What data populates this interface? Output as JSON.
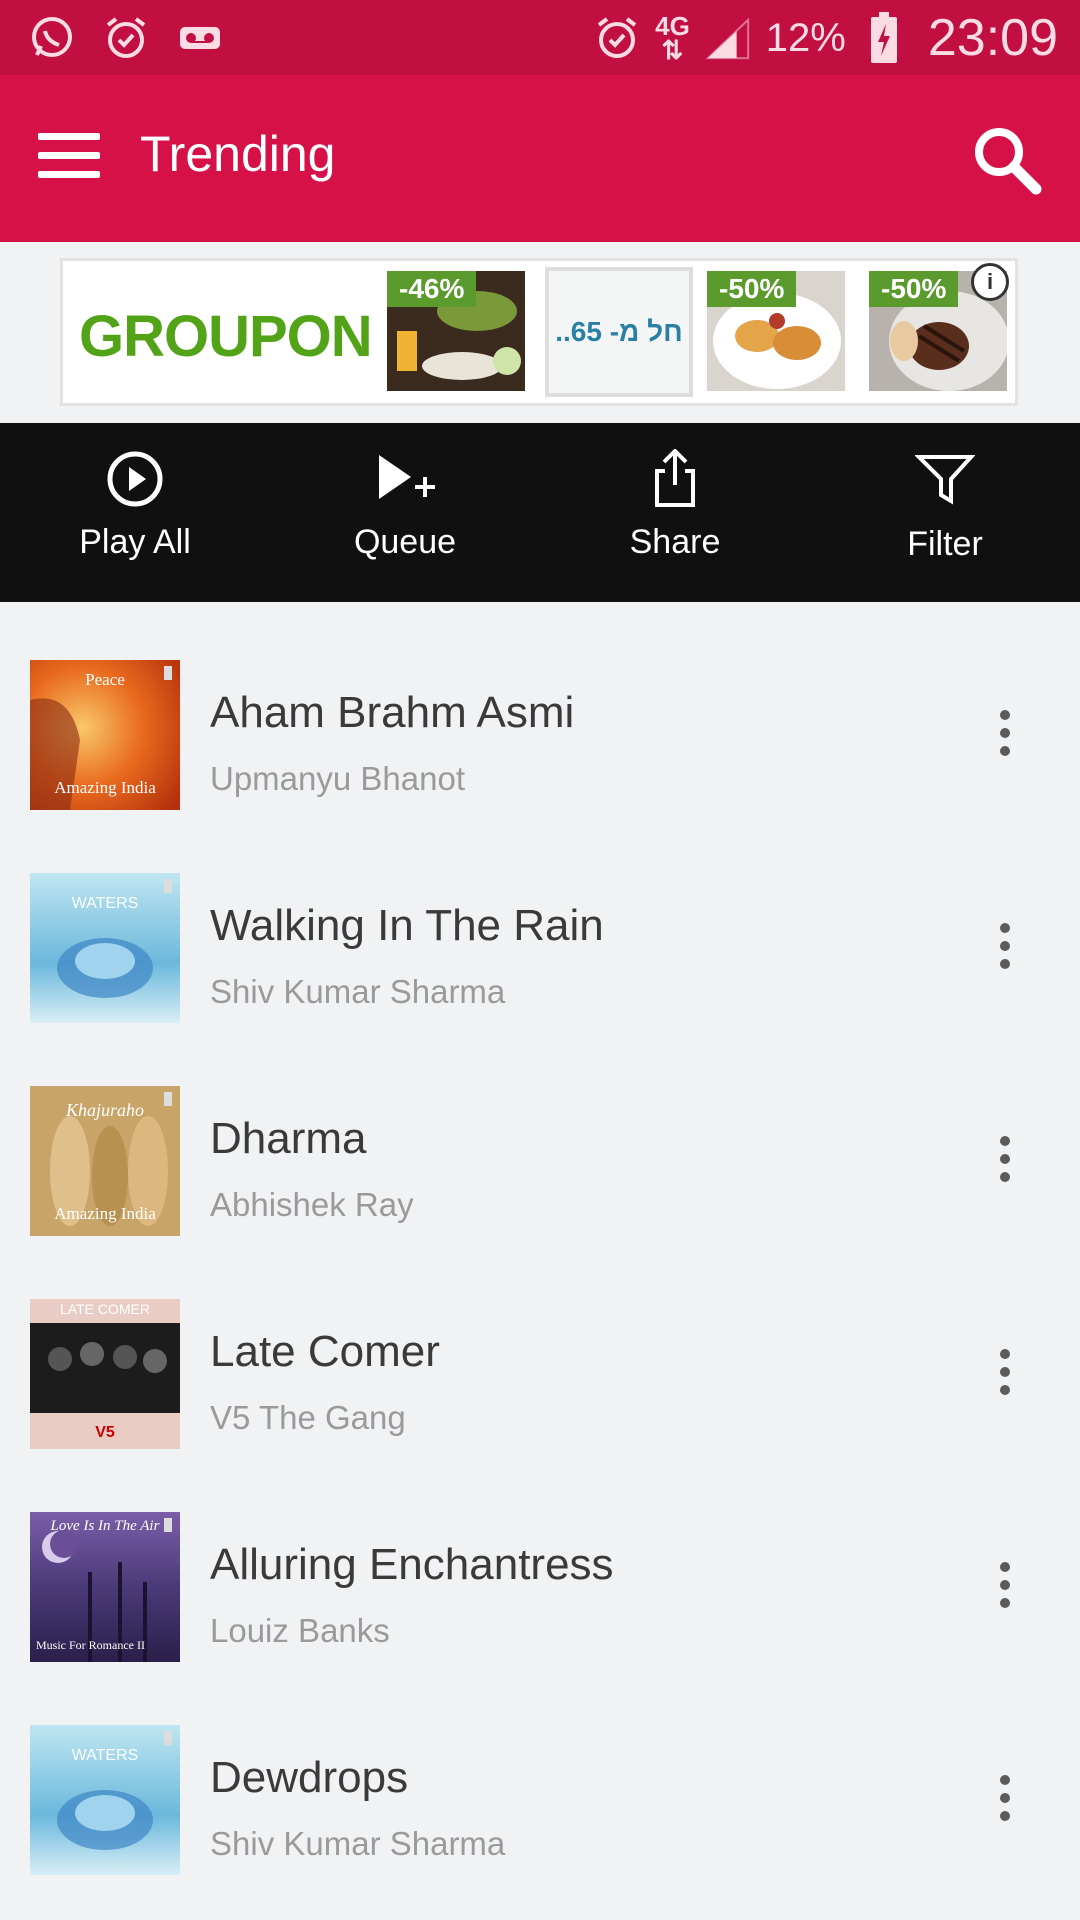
{
  "status_bar": {
    "battery": "12%",
    "network": "4G",
    "time": "23:09",
    "icons": [
      "whatsapp-icon",
      "alarm-icon",
      "voicemail-icon",
      "alarm-icon",
      "signal-icon",
      "battery-charging-icon"
    ]
  },
  "app_bar": {
    "title": "Trending",
    "menu_icon": "hamburger-menu-icon",
    "search_icon": "search-icon"
  },
  "ad": {
    "brand": "GROUPON",
    "deals": [
      {
        "badge": "-46%"
      },
      {
        "text": "..חל מ- 65"
      },
      {
        "badge": "-50%"
      },
      {
        "badge": "-50%"
      }
    ],
    "info_icon": "info-icon"
  },
  "toolbar": {
    "play_all": "Play All",
    "queue": "Queue",
    "share": "Share",
    "filter": "Filter"
  },
  "songs": [
    {
      "title": "Aham Brahm Asmi",
      "artist": "Upmanyu Bhanot",
      "art_caption_top": "Peace",
      "art_caption_bottom": "Amazing India"
    },
    {
      "title": "Walking In The Rain",
      "artist": "Shiv Kumar Sharma",
      "art_caption_top": "WATERS",
      "art_caption_bottom": ""
    },
    {
      "title": "Dharma",
      "artist": "Abhishek Ray",
      "art_caption_top": "Khajuraho",
      "art_caption_bottom": "Amazing India"
    },
    {
      "title": "Late Comer",
      "artist": "V5 The Gang",
      "art_caption_top": "LATE COMER",
      "art_caption_bottom": "V5"
    },
    {
      "title": "Alluring Enchantress",
      "artist": "Louiz Banks",
      "art_caption_top": "Love Is In The Air",
      "art_caption_bottom": "Music For Romance II"
    },
    {
      "title": "Dewdrops",
      "artist": "Shiv Kumar Sharma",
      "art_caption_top": "WATERS",
      "art_caption_bottom": ""
    }
  ],
  "colors": {
    "status_bar": "#c20f42",
    "app_bar": "#d61148",
    "toolbar": "#101010",
    "background": "#f1f2f4"
  }
}
